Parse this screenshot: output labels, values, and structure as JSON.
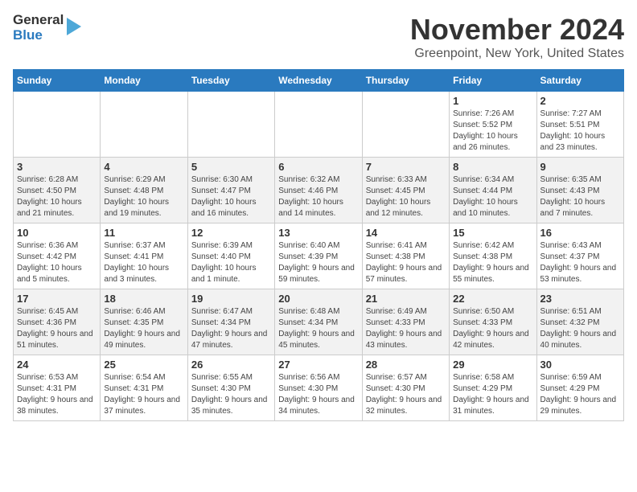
{
  "logo": {
    "line1": "General",
    "line2": "Blue"
  },
  "header": {
    "month": "November 2024",
    "location": "Greenpoint, New York, United States"
  },
  "weekdays": [
    "Sunday",
    "Monday",
    "Tuesday",
    "Wednesday",
    "Thursday",
    "Friday",
    "Saturday"
  ],
  "weeks": [
    [
      null,
      null,
      null,
      null,
      null,
      {
        "day": "1",
        "info": "Sunrise: 7:26 AM\nSunset: 5:52 PM\nDaylight: 10 hours and 26 minutes."
      },
      {
        "day": "2",
        "info": "Sunrise: 7:27 AM\nSunset: 5:51 PM\nDaylight: 10 hours and 23 minutes."
      }
    ],
    [
      {
        "day": "3",
        "info": "Sunrise: 6:28 AM\nSunset: 4:50 PM\nDaylight: 10 hours and 21 minutes."
      },
      {
        "day": "4",
        "info": "Sunrise: 6:29 AM\nSunset: 4:48 PM\nDaylight: 10 hours and 19 minutes."
      },
      {
        "day": "5",
        "info": "Sunrise: 6:30 AM\nSunset: 4:47 PM\nDaylight: 10 hours and 16 minutes."
      },
      {
        "day": "6",
        "info": "Sunrise: 6:32 AM\nSunset: 4:46 PM\nDaylight: 10 hours and 14 minutes."
      },
      {
        "day": "7",
        "info": "Sunrise: 6:33 AM\nSunset: 4:45 PM\nDaylight: 10 hours and 12 minutes."
      },
      {
        "day": "8",
        "info": "Sunrise: 6:34 AM\nSunset: 4:44 PM\nDaylight: 10 hours and 10 minutes."
      },
      {
        "day": "9",
        "info": "Sunrise: 6:35 AM\nSunset: 4:43 PM\nDaylight: 10 hours and 7 minutes."
      }
    ],
    [
      {
        "day": "10",
        "info": "Sunrise: 6:36 AM\nSunset: 4:42 PM\nDaylight: 10 hours and 5 minutes."
      },
      {
        "day": "11",
        "info": "Sunrise: 6:37 AM\nSunset: 4:41 PM\nDaylight: 10 hours and 3 minutes."
      },
      {
        "day": "12",
        "info": "Sunrise: 6:39 AM\nSunset: 4:40 PM\nDaylight: 10 hours and 1 minute."
      },
      {
        "day": "13",
        "info": "Sunrise: 6:40 AM\nSunset: 4:39 PM\nDaylight: 9 hours and 59 minutes."
      },
      {
        "day": "14",
        "info": "Sunrise: 6:41 AM\nSunset: 4:38 PM\nDaylight: 9 hours and 57 minutes."
      },
      {
        "day": "15",
        "info": "Sunrise: 6:42 AM\nSunset: 4:38 PM\nDaylight: 9 hours and 55 minutes."
      },
      {
        "day": "16",
        "info": "Sunrise: 6:43 AM\nSunset: 4:37 PM\nDaylight: 9 hours and 53 minutes."
      }
    ],
    [
      {
        "day": "17",
        "info": "Sunrise: 6:45 AM\nSunset: 4:36 PM\nDaylight: 9 hours and 51 minutes."
      },
      {
        "day": "18",
        "info": "Sunrise: 6:46 AM\nSunset: 4:35 PM\nDaylight: 9 hours and 49 minutes."
      },
      {
        "day": "19",
        "info": "Sunrise: 6:47 AM\nSunset: 4:34 PM\nDaylight: 9 hours and 47 minutes."
      },
      {
        "day": "20",
        "info": "Sunrise: 6:48 AM\nSunset: 4:34 PM\nDaylight: 9 hours and 45 minutes."
      },
      {
        "day": "21",
        "info": "Sunrise: 6:49 AM\nSunset: 4:33 PM\nDaylight: 9 hours and 43 minutes."
      },
      {
        "day": "22",
        "info": "Sunrise: 6:50 AM\nSunset: 4:33 PM\nDaylight: 9 hours and 42 minutes."
      },
      {
        "day": "23",
        "info": "Sunrise: 6:51 AM\nSunset: 4:32 PM\nDaylight: 9 hours and 40 minutes."
      }
    ],
    [
      {
        "day": "24",
        "info": "Sunrise: 6:53 AM\nSunset: 4:31 PM\nDaylight: 9 hours and 38 minutes."
      },
      {
        "day": "25",
        "info": "Sunrise: 6:54 AM\nSunset: 4:31 PM\nDaylight: 9 hours and 37 minutes."
      },
      {
        "day": "26",
        "info": "Sunrise: 6:55 AM\nSunset: 4:30 PM\nDaylight: 9 hours and 35 minutes."
      },
      {
        "day": "27",
        "info": "Sunrise: 6:56 AM\nSunset: 4:30 PM\nDaylight: 9 hours and 34 minutes."
      },
      {
        "day": "28",
        "info": "Sunrise: 6:57 AM\nSunset: 4:30 PM\nDaylight: 9 hours and 32 minutes."
      },
      {
        "day": "29",
        "info": "Sunrise: 6:58 AM\nSunset: 4:29 PM\nDaylight: 9 hours and 31 minutes."
      },
      {
        "day": "30",
        "info": "Sunrise: 6:59 AM\nSunset: 4:29 PM\nDaylight: 9 hours and 29 minutes."
      }
    ]
  ]
}
